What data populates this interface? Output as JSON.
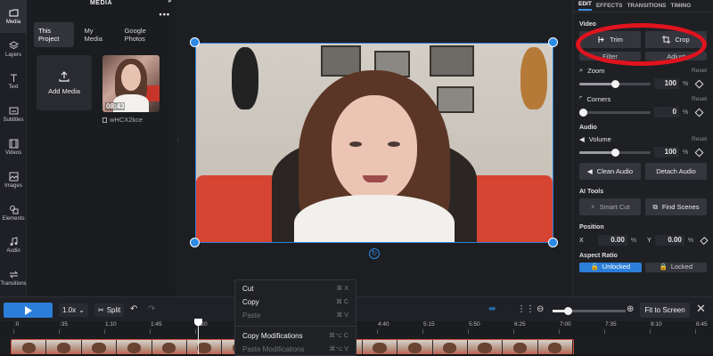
{
  "rail": {
    "items": [
      {
        "label": "Media",
        "icon": "media-icon",
        "active": true
      },
      {
        "label": "Layers",
        "icon": "layers-icon"
      },
      {
        "label": "Text",
        "icon": "text-icon"
      },
      {
        "label": "Subtitles",
        "icon": "subtitles-icon"
      },
      {
        "label": "Videos",
        "icon": "videos-icon"
      },
      {
        "label": "Images",
        "icon": "images-icon"
      },
      {
        "label": "Elements",
        "icon": "elements-icon"
      },
      {
        "label": "Audio",
        "icon": "audio-icon"
      },
      {
        "label": "Transitions",
        "icon": "transitions-icon"
      }
    ]
  },
  "media": {
    "title": "MEDIA",
    "tabs": [
      {
        "label": "This Project",
        "active": true
      },
      {
        "label": "My Media"
      },
      {
        "label": "Google Photos"
      }
    ],
    "add_media_label": "Add Media",
    "clip": {
      "duration": "08:43",
      "name": "wHCX2kce"
    }
  },
  "context_menu": {
    "items": [
      {
        "label": "Cut",
        "shortcut": "⌘ X",
        "disabled": false
      },
      {
        "label": "Copy",
        "shortcut": "⌘ C",
        "disabled": false
      },
      {
        "label": "Paste",
        "shortcut": "⌘ V",
        "disabled": true
      },
      {
        "label": "Copy Modifications",
        "shortcut": "⌘⌥ C",
        "disabled": false
      },
      {
        "label": "Paste Modifications",
        "shortcut": "⌘⌥ V",
        "disabled": true
      }
    ]
  },
  "right_panel": {
    "tabs": [
      "EDIT",
      "EFFECTS",
      "TRANSITIONS",
      "TIMING"
    ],
    "active_tab": "EDIT",
    "video_label": "Video",
    "trim_label": "Trim",
    "crop_label": "Crop",
    "filter_label": "Filter",
    "adjust_label": "Adjust",
    "zoom": {
      "label": "Zoom",
      "reset": "Reset",
      "value": "100",
      "unit": "%",
      "level": 0.5
    },
    "corners": {
      "label": "Corners",
      "reset": "Reset",
      "value": "0",
      "unit": "%",
      "level": 0.0
    },
    "audio_label": "Audio",
    "volume": {
      "label": "Volume",
      "reset": "Reset",
      "value": "100",
      "unit": "%",
      "level": 0.5
    },
    "clean_audio_label": "Clean Audio",
    "detach_audio_label": "Detach Audio",
    "ai_tools_label": "AI Tools",
    "smart_cut_label": "Smart Cut",
    "find_scenes_label": "Find Scenes",
    "position": {
      "label": "Position",
      "x_label": "X",
      "x_value": "0.00",
      "y_label": "Y",
      "y_value": "0.00",
      "unit": "%"
    },
    "aspect_ratio_label": "Aspect Ratio",
    "unlocked_label": "Unlocked",
    "locked_label": "Locked"
  },
  "timeline": {
    "speed_label": "1.0x",
    "split_label": "Split",
    "fit_label": "Fit to Screen",
    "zoom_level": 0.22,
    "ticks": [
      ":0",
      ":35",
      "1:10",
      "1:45",
      "2:20",
      "",
      "",
      "",
      "4:40",
      "5:15",
      "5:50",
      "6:25",
      "7:00",
      "7:35",
      "8:10",
      "8:45"
    ]
  },
  "colors": {
    "accent": "#2b7fd8",
    "annotation": "#e0141e"
  }
}
